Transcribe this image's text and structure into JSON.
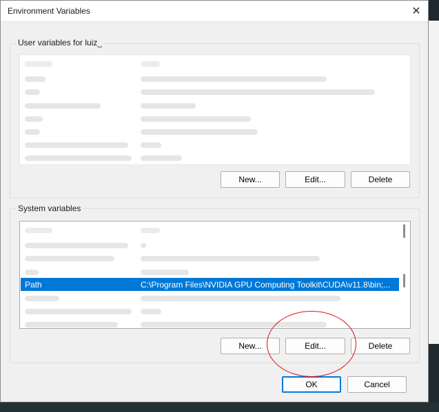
{
  "window": {
    "title": "Environment Variables",
    "close_icon": "✕"
  },
  "user_section": {
    "label": "User variables for luiz_",
    "buttons": {
      "new": "New...",
      "edit": "Edit...",
      "delete": "Delete"
    }
  },
  "system_section": {
    "label": "System variables",
    "selected_row": {
      "variable": "Path",
      "value": "C:\\Program Files\\NVIDIA GPU Computing Toolkit\\CUDA\\v11.8\\bin;..."
    },
    "buttons": {
      "new": "New...",
      "edit": "Edit...",
      "delete": "Delete"
    }
  },
  "footer": {
    "ok": "OK",
    "cancel": "Cancel"
  },
  "colors": {
    "selection": "#0078d7",
    "annotation": "#e01010",
    "dialog_bg": "#f0f0f0"
  }
}
